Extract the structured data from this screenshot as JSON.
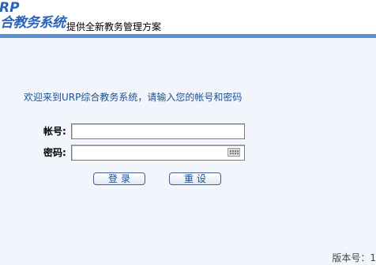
{
  "header": {
    "logo_line1": "RP",
    "logo_line2": "合教务系统",
    "tagline": "提供全新教务管理方案"
  },
  "login": {
    "welcome": "欢迎来到URP综合教务系统，请输入您的帐号和密码",
    "account_label": "帐号:",
    "account_value": "",
    "password_label": "密码:",
    "password_value": "",
    "login_button": "登录",
    "reset_button": "重设"
  },
  "footer": {
    "version": "版本号：1"
  },
  "colors": {
    "background": "#f2f6fc",
    "brand_blue": "#2a63b8",
    "header_bar": "#5a8fcf",
    "text_blue": "#1b4f93"
  },
  "icons": {
    "password_field": "keyboard-icon"
  }
}
